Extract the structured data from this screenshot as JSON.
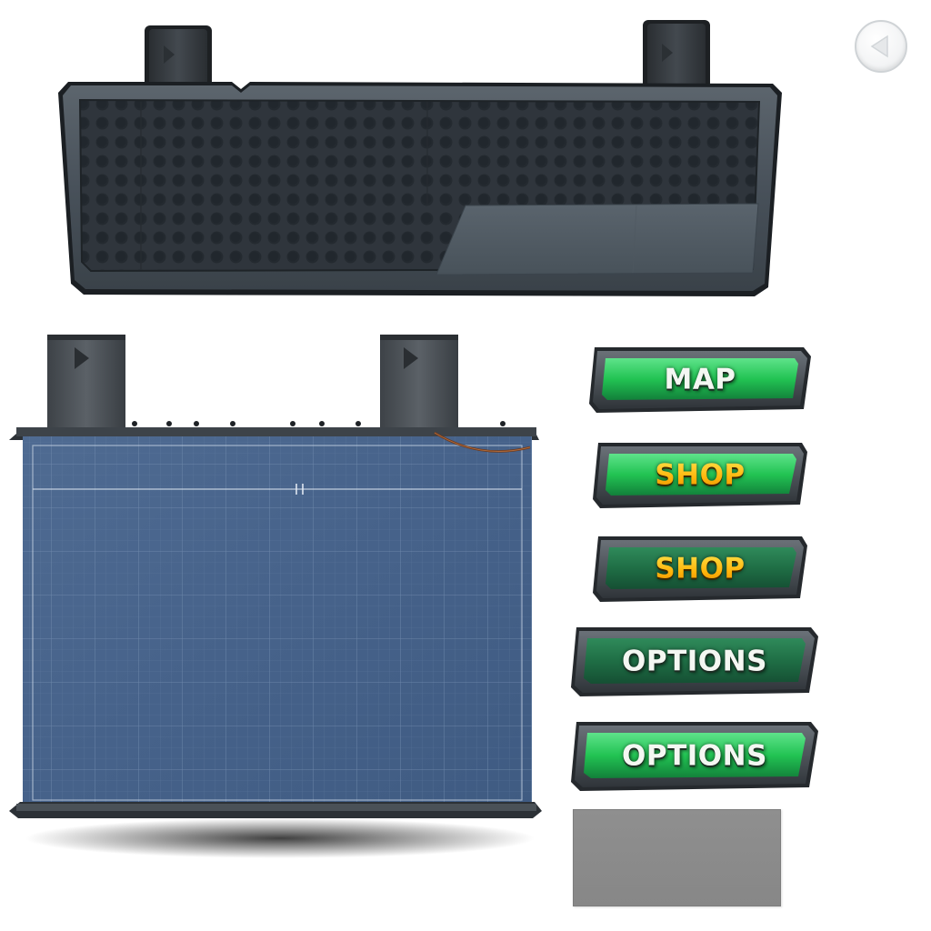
{
  "menu": {
    "map_label": "MAP",
    "shop_active_label": "SHOP",
    "shop_label": "SHOP",
    "options_label": "OPTIONS",
    "options_active_label": "OPTIONS"
  },
  "icons": {
    "back": "back-arrow-icon"
  },
  "colors": {
    "button_green_bright": "#1fc24e",
    "button_green_dark": "#1e6b44",
    "button_frame": "#3a3f44",
    "label_gold": "#ffc21a",
    "label_white": "#f4f7f2",
    "blueprint_blue": "#48648a",
    "panel_dark": "#2b3035",
    "swatch_grey": "#8a8a8a"
  }
}
